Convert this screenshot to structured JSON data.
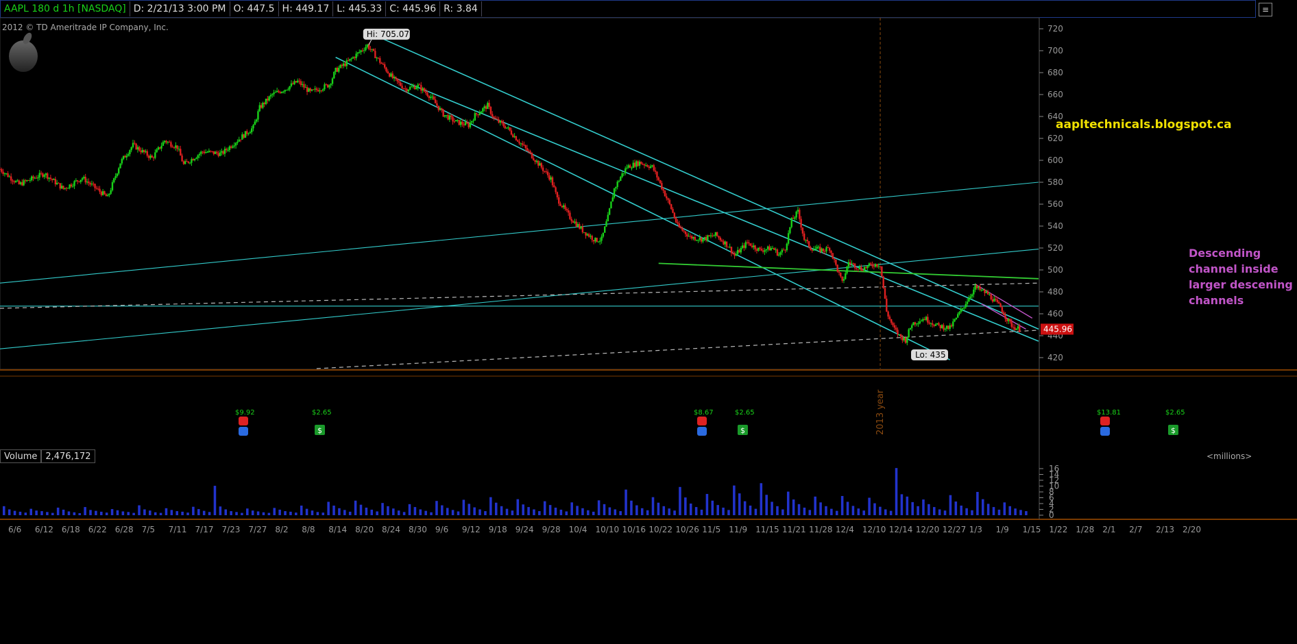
{
  "header": {
    "symbol": "AAPL 180 d 1h [NASDAQ]",
    "date": "D: 2/21/13 3:00 PM",
    "open": "O: 447.5",
    "high": "H: 449.17",
    "low": "L: 445.33",
    "close": "C: 445.96",
    "range": "R: 3.84"
  },
  "copyright": "2012 © TD Ameritrade IP Company, Inc.",
  "price_panel": {
    "hi_label": "Hi: 705.07",
    "lo_label": "Lo: 435",
    "last_price": "445.96",
    "year_marker": "2013 year",
    "blog": "aapltechnicals.blogspot.ca",
    "annotation_lines": [
      "Descending",
      "channel inside",
      "larger descening",
      "channels"
    ],
    "event_labels": [
      "$9.92",
      "$2.65",
      "$8.67",
      "$2.65",
      "$13.81",
      "$2.65"
    ],
    "colors": {
      "channel": "#33cccc",
      "green_line": "#33cc33",
      "dotted": "#bbbbbb",
      "blog": "#f0e000",
      "annotation": "#c155c8",
      "last_price_bg": "#cc1111",
      "up": "#19d219",
      "down": "#e02020"
    }
  },
  "volume_panel": {
    "label": "Volume",
    "value": "2,476,172",
    "units": "<millions>"
  },
  "chart_data": [
    {
      "type": "candlestick",
      "title": "AAPL 180 d 1h [NASDAQ]",
      "ylim": [
        410,
        730
      ],
      "y_ticks": [
        420,
        440,
        460,
        480,
        500,
        520,
        540,
        560,
        580,
        600,
        620,
        640,
        660,
        680,
        700,
        720
      ],
      "x_ticks": [
        "6/6",
        "6/12",
        "6/18",
        "6/22",
        "6/28",
        "7/5",
        "7/11",
        "7/17",
        "7/23",
        "7/27",
        "8/2",
        "8/8",
        "8/14",
        "8/20",
        "8/24",
        "8/30",
        "9/6",
        "9/12",
        "9/18",
        "9/24",
        "9/28",
        "10/4",
        "10/10",
        "10/16",
        "10/22",
        "10/26",
        "11/5",
        "11/9",
        "11/15",
        "11/21",
        "11/28",
        "12/4",
        "12/10",
        "12/14",
        "12/20",
        "12/27",
        "1/3",
        "1/9",
        "1/15",
        "1/22",
        "1/28",
        "2/1",
        "2/7",
        "2/13",
        "2/20"
      ],
      "price_path": [
        [
          0,
          592
        ],
        [
          3,
          578
        ],
        [
          7,
          588
        ],
        [
          10,
          574
        ],
        [
          13,
          584
        ],
        [
          17,
          566
        ],
        [
          19,
          598
        ],
        [
          21,
          614
        ],
        [
          24,
          602
        ],
        [
          26,
          618
        ],
        [
          28,
          612
        ],
        [
          29,
          596
        ],
        [
          30,
          600
        ],
        [
          32,
          608
        ],
        [
          35,
          606
        ],
        [
          37,
          616
        ],
        [
          40,
          630
        ],
        [
          41,
          648
        ],
        [
          43,
          660
        ],
        [
          45,
          665
        ],
        [
          47,
          672
        ],
        [
          49,
          662
        ],
        [
          52,
          669
        ],
        [
          53,
          682
        ],
        [
          55,
          690
        ],
        [
          57,
          700
        ],
        [
          58,
          705
        ],
        [
          60,
          690
        ],
        [
          62,
          675
        ],
        [
          64,
          665
        ],
        [
          66,
          668
        ],
        [
          68,
          658
        ],
        [
          70,
          642
        ],
        [
          72,
          635
        ],
        [
          74,
          632
        ],
        [
          75,
          641
        ],
        [
          77,
          650
        ],
        [
          78,
          638
        ],
        [
          80,
          630
        ],
        [
          82,
          617
        ],
        [
          84,
          604
        ],
        [
          86,
          590
        ],
        [
          87,
          583
        ],
        [
          88,
          565
        ],
        [
          90,
          548
        ],
        [
          92,
          536
        ],
        [
          94,
          527
        ],
        [
          95,
          528
        ],
        [
          96,
          548
        ],
        [
          97,
          574
        ],
        [
          98,
          585
        ],
        [
          99,
          594
        ],
        [
          101,
          598
        ],
        [
          103,
          594
        ],
        [
          104,
          582
        ],
        [
          106,
          556
        ],
        [
          107,
          540
        ],
        [
          109,
          530
        ],
        [
          111,
          528
        ],
        [
          113,
          532
        ],
        [
          115,
          522
        ],
        [
          116,
          513
        ],
        [
          118,
          525
        ],
        [
          120,
          518
        ],
        [
          122,
          520
        ],
        [
          123,
          514
        ],
        [
          124,
          520
        ],
        [
          125,
          545
        ],
        [
          126,
          553
        ],
        [
          127,
          528
        ],
        [
          128,
          520
        ],
        [
          130,
          518
        ],
        [
          131,
          520
        ],
        [
          132,
          504
        ],
        [
          133,
          488
        ],
        [
          134,
          507
        ],
        [
          136,
          501
        ],
        [
          138,
          505
        ],
        [
          139,
          505
        ],
        [
          140,
          462
        ],
        [
          141,
          448
        ],
        [
          142,
          440
        ],
        [
          143,
          436
        ],
        [
          144,
          451
        ],
        [
          146,
          456
        ],
        [
          148,
          449
        ],
        [
          150,
          447
        ],
        [
          152,
          465
        ],
        [
          153,
          475
        ],
        [
          154,
          484
        ],
        [
          156,
          478
        ],
        [
          158,
          466
        ],
        [
          159,
          455
        ],
        [
          160,
          448
        ],
        [
          161,
          446
        ]
      ],
      "extremes": {
        "high": 705.07,
        "low": 435,
        "last": 445.96
      },
      "trendlines": [
        {
          "name": "outer channel upper",
          "from": [
            60,
            712
          ],
          "to": [
            164,
            446
          ]
        },
        {
          "name": "outer channel lower",
          "from": [
            53,
            694
          ],
          "to": [
            150,
            418
          ]
        },
        {
          "name": "middle channel",
          "from": [
            62,
            676
          ],
          "to": [
            164,
            435
          ]
        },
        {
          "name": "rising line 1",
          "from": [
            0,
            488
          ],
          "to": [
            164,
            580
          ]
        },
        {
          "name": "rising line 2",
          "from": [
            0,
            428
          ],
          "to": [
            164,
            519
          ]
        },
        {
          "name": "horizontal",
          "from": [
            0,
            467
          ],
          "to": [
            164,
            467
          ]
        },
        {
          "name": "green support",
          "from": [
            104,
            506
          ],
          "to": [
            164,
            492
          ]
        },
        {
          "name": "small channel upper",
          "from": [
            154,
            487
          ],
          "to": [
            163,
            456
          ]
        },
        {
          "name": "small channel lower",
          "from": [
            155,
            469
          ],
          "to": [
            162,
            446
          ]
        },
        {
          "name": "dotted 1",
          "from": [
            0,
            465
          ],
          "to": [
            164,
            488
          ]
        },
        {
          "name": "dotted 2",
          "from": [
            50,
            410
          ],
          "to": [
            164,
            445
          ]
        }
      ]
    },
    {
      "type": "bar",
      "title": "Volume",
      "ylabel": "<millions>",
      "ylim": [
        0,
        17
      ],
      "y_ticks": [
        0,
        2,
        4,
        6,
        8,
        10,
        12,
        14,
        16
      ],
      "values": [
        3.1,
        2.0,
        1.5,
        1.2,
        0.9,
        2.2,
        1.6,
        1.4,
        1.1,
        0.8,
        2.6,
        1.9,
        1.3,
        1.0,
        0.7,
        2.8,
        1.8,
        1.5,
        1.2,
        0.9,
        2.1,
        1.7,
        1.3,
        1.1,
        0.8,
        3.4,
        2.0,
        1.6,
        1.0,
        0.8,
        2.4,
        1.8,
        1.4,
        1.2,
        0.9,
        2.9,
        2.1,
        1.5,
        1.1,
        10.1,
        3.0,
        2.0,
        1.4,
        1.1,
        0.8,
        2.3,
        1.6,
        1.3,
        1.0,
        0.8,
        2.5,
        1.9,
        1.4,
        1.2,
        0.9,
        3.3,
        2.2,
        1.6,
        1.1,
        0.9,
        4.6,
        3.3,
        2.4,
        1.8,
        1.2,
        5.0,
        3.6,
        2.6,
        1.9,
        1.3,
        4.2,
        3.1,
        2.3,
        1.6,
        1.1,
        3.8,
        2.8,
        2.0,
        1.5,
        1.0,
        4.9,
        3.4,
        2.5,
        1.8,
        1.3,
        5.3,
        3.9,
        2.7,
        2.0,
        1.4,
        6.2,
        4.3,
        3.1,
        2.2,
        1.6,
        5.5,
        3.7,
        2.8,
        2.0,
        1.4,
        4.8,
        3.5,
        2.6,
        1.9,
        1.3,
        4.4,
        3.2,
        2.4,
        1.7,
        1.2,
        5.1,
        3.8,
        2.7,
        2.0,
        1.4,
        8.8,
        5.0,
        3.4,
        2.4,
        1.7,
        6.2,
        4.3,
        3.1,
        2.3,
        1.6,
        9.7,
        6.1,
        4.0,
        2.8,
        1.9,
        7.3,
        5.0,
        3.5,
        2.6,
        1.8,
        10.2,
        7.5,
        4.8,
        3.3,
        2.2,
        11.0,
        7.0,
        4.6,
        3.1,
        2.0,
        8.1,
        5.4,
        3.8,
        2.6,
        1.8,
        6.4,
        4.4,
        3.1,
        2.2,
        1.5,
        6.6,
        4.6,
        3.2,
        2.3,
        1.6,
        6.0,
        4.1,
        2.9,
        2.0,
        1.5,
        16.2,
        7.2,
        6.4,
        4.5,
        3.1,
        5.4,
        3.8,
        2.8,
        2.0,
        1.6,
        6.9,
        4.7,
        3.3,
        2.4,
        1.7,
        8.0,
        5.5,
        3.9,
        2.8,
        1.9,
        4.4,
        3.1,
        2.3,
        1.8,
        1.4
      ]
    }
  ]
}
